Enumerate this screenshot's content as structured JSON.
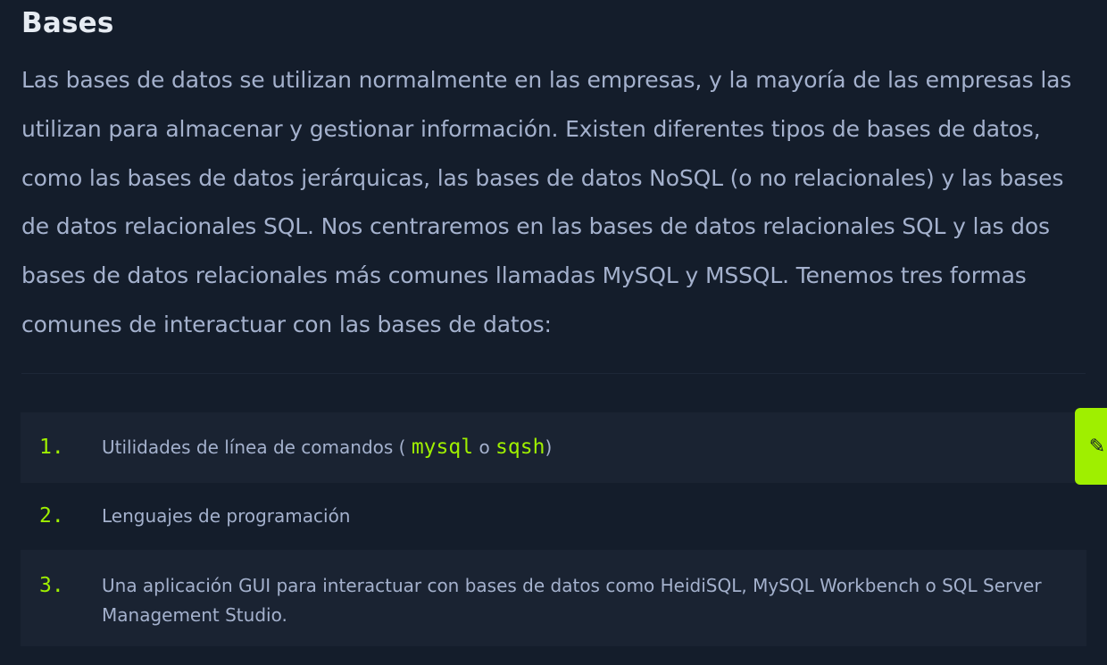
{
  "section": {
    "title": "Bases",
    "intro": "Las bases de datos se utilizan normalmente en las empresas, y la mayoría de las empresas las utilizan para almacenar y gestionar información. Existen diferentes tipos de bases de datos, como las bases de datos jerárquicas, las bases de datos NoSQL (o no relacionales) y las bases de datos relacionales SQL. Nos centraremos en las bases de datos relacionales SQL y las dos bases de datos relacionales más comunes llamadas MySQL y MSSQL. Tenemos tres formas comunes de interactuar con las bases de datos:"
  },
  "list": [
    {
      "number": "1.",
      "text_before": "Utilidades de línea de comandos (",
      "code_1": "mysql",
      "text_middle": "o",
      "code_2": "sqsh",
      "text_after": ")"
    },
    {
      "number": "2.",
      "text": "Lenguajes de programación"
    },
    {
      "number": "3.",
      "text": "Una aplicación GUI para interactuar con bases de datos como HeidiSQL, MySQL Workbench o SQL Server Management Studio."
    }
  ],
  "edit_tab": {
    "icon": "pencil-icon",
    "glyph": "✎",
    "color": "#9fef00"
  },
  "colors": {
    "background": "#141d2b",
    "accent": "#9fef00",
    "text": "#a4b1cd",
    "heading": "#e6ebf2"
  }
}
